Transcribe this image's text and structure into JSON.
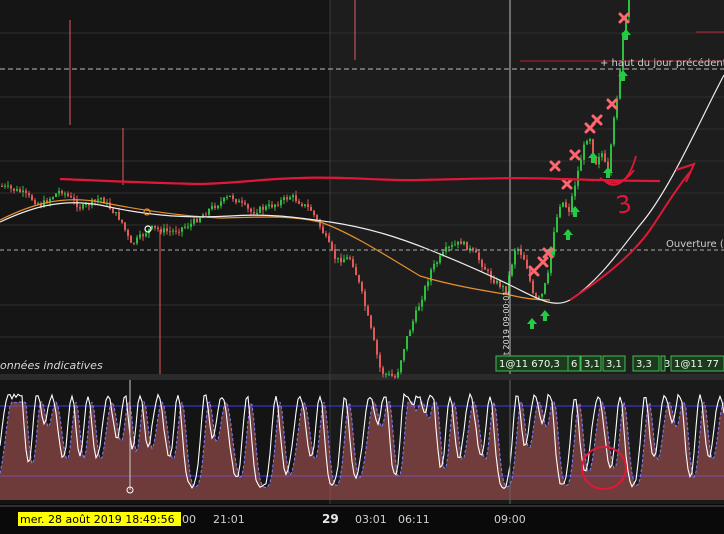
{
  "chart_data": {
    "type": "candlestick",
    "main": {
      "open_label": "Ouverture (",
      "prev_high_label": "+ haut du jour précédent",
      "indicative_label": "onnées indicatives",
      "vertical_label": "août 2019 09:00:01",
      "order_labels": [
        "1@11 670,3",
        "6",
        "3,1",
        "3,1",
        "3,3",
        "3,1",
        "1@11 77"
      ]
    },
    "oscillator": {
      "type": "stochastic"
    },
    "x_ticks": [
      "00",
      "21:01",
      "29",
      "03:01",
      "06:11",
      "09:00"
    ],
    "cursor_date": "mer. 28 août 2019 18:49:56",
    "annotations": [
      "3"
    ],
    "colors": {
      "background": "#111111",
      "up_candle": "#2fbf3f",
      "down_candle": "#e05a5a",
      "ma_orange": "#e8902a",
      "ma_white": "#eeeeee",
      "resistance": "#e01838",
      "osc_band": "#3a3aff",
      "buy_arrow": "#22cc44",
      "sell_cross": "#ff6670",
      "date_highlight": "#ffff00"
    }
  }
}
